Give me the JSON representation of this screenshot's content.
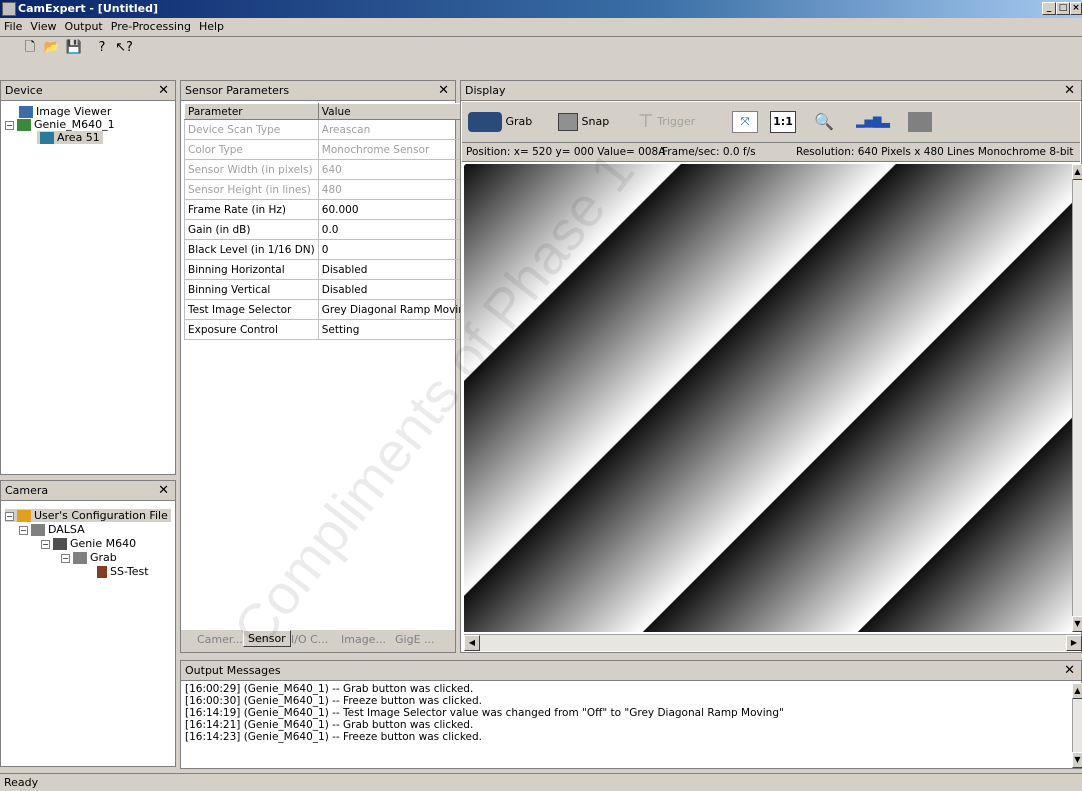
{
  "window": {
    "title": "CamExpert - [Untitled]"
  },
  "menu": [
    "File",
    "View",
    "Output",
    "Pre-Processing",
    "Help"
  ],
  "device_panel": {
    "title": "Device",
    "items": [
      "Image Viewer",
      "Genie_M640_1",
      "Area 51"
    ]
  },
  "camera_panel": {
    "title": "Camera",
    "items": [
      "User's Configuration File",
      "DALSA",
      "Genie M640",
      "Grab",
      "SS-Test"
    ]
  },
  "sensor_panel": {
    "title": "Sensor Parameters",
    "columns": [
      "Parameter",
      "Value"
    ],
    "rows": [
      [
        "Device Scan Type",
        "Areascan"
      ],
      [
        "Color Type",
        "Monochrome Sensor"
      ],
      [
        "Sensor Width (in pixels)",
        "640"
      ],
      [
        "Sensor Height (in lines)",
        "480"
      ],
      [
        "Frame Rate (in Hz)",
        "60.000"
      ],
      [
        "Gain (in dB)",
        "0.0"
      ],
      [
        "Black Level (in 1/16 DN)",
        "0"
      ],
      [
        "Binning Horizontal",
        "Disabled"
      ],
      [
        "Binning Vertical",
        "Disabled"
      ],
      [
        "Test Image Selector",
        "Grey Diagonal Ramp Moving"
      ],
      [
        "Exposure Control",
        "Setting"
      ]
    ],
    "tabs": [
      "Camer...",
      "Sensor",
      "I/O C...",
      "Image...",
      "GigE ..."
    ]
  },
  "display_panel": {
    "title": "Display",
    "grab_label": "Grab",
    "snap_label": "Snap",
    "trigger_label": "Trigger",
    "scale_label": "1:1",
    "position": "Position:  x= 520 y= 000 Value= 008A",
    "framerate": "Frame/sec:  0.0 f/s",
    "resolution": "Resolution:  640 Pixels x 480 Lines  Monochrome 8-bit"
  },
  "output_panel": {
    "title": "Output Messages",
    "lines": [
      "[16:00:29] (Genie_M640_1)  -- Grab button was clicked.",
      "[16:00:30] (Genie_M640_1)  -- Freeze button was clicked.",
      "[16:14:19] (Genie_M640_1)  -- Test Image Selector value was changed from \"Off\" to \"Grey Diagonal Ramp Moving\"",
      "[16:14:21] (Genie_M640_1)  -- Grab button was clicked.",
      "[16:14:23] (Genie_M640_1)  -- Freeze button was clicked."
    ]
  },
  "status": {
    "text": "Ready"
  },
  "watermark": "Compliments of Phase 1",
  "colors": {
    "titlebar": "#0a246a",
    "panel_bg": "#d4d0c8"
  }
}
